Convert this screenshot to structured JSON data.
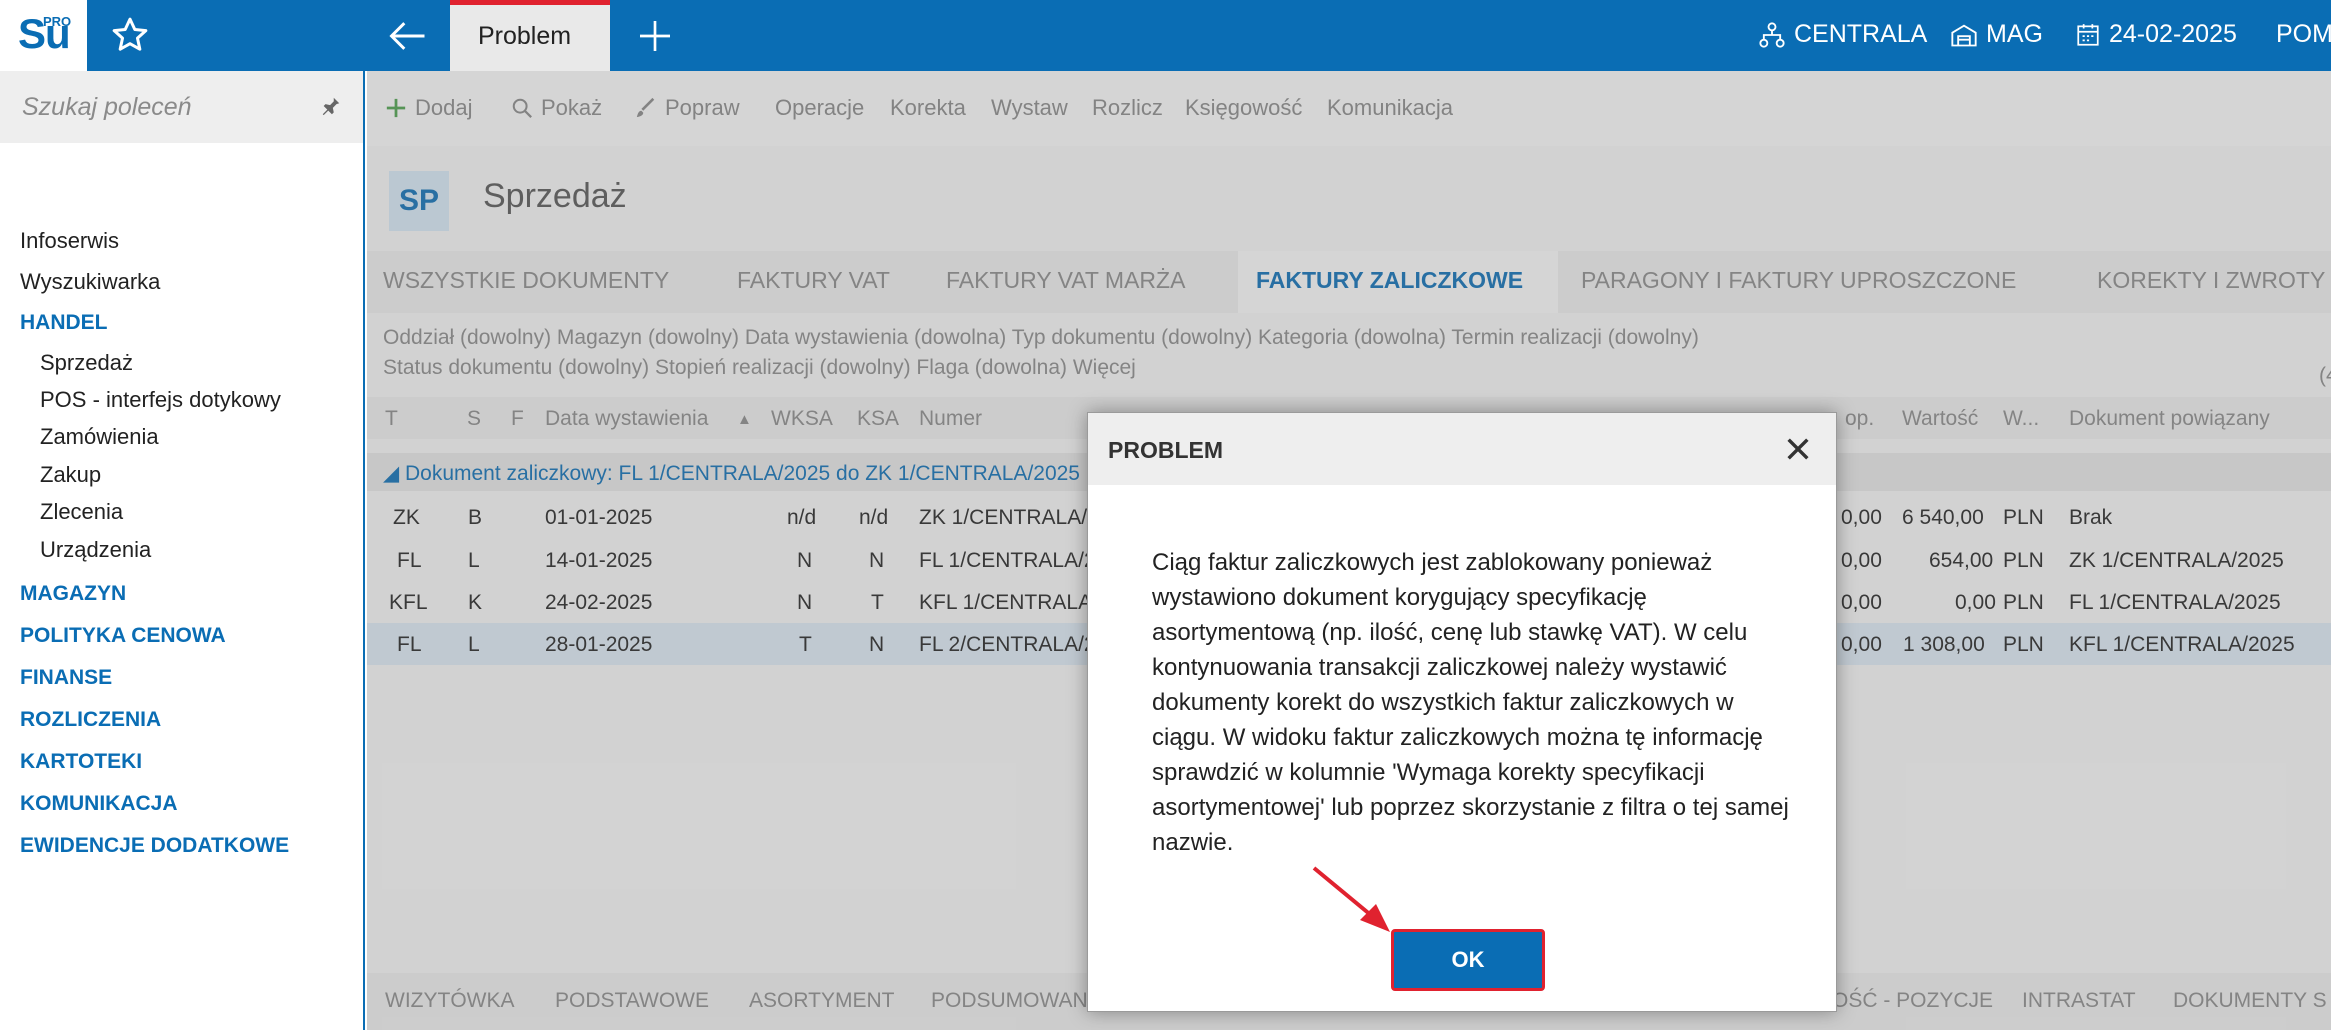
{
  "topbar": {
    "logo_text": "Su",
    "logo_sup": "PRO",
    "active_tab": "Problem",
    "centrala": "CENTRALA",
    "mag": "MAG",
    "date": "24-02-2025",
    "pom": "POM",
    "accent": "#0a6db4",
    "tab_border": "#e0222f"
  },
  "sidebar": {
    "search_placeholder": "Szukaj poleceń",
    "items": [
      {
        "label": "Infoserwis"
      },
      {
        "label": "Wyszukiwarka"
      },
      {
        "label": "HANDEL"
      },
      {
        "label": "Sprzedaż"
      },
      {
        "label": "POS - interfejs dotykowy"
      },
      {
        "label": "Zamówienia"
      },
      {
        "label": "Zakup"
      },
      {
        "label": "Zlecenia"
      },
      {
        "label": "Urządzenia"
      },
      {
        "label": "MAGAZYN"
      },
      {
        "label": "POLITYKA CENOWA"
      },
      {
        "label": "FINANSE"
      },
      {
        "label": "ROZLICZENIA"
      },
      {
        "label": "KARTOTEKI"
      },
      {
        "label": "KOMUNIKACJA"
      },
      {
        "label": "EWIDENCJE DODATKOWE"
      }
    ]
  },
  "toolbar": {
    "dodaj": "Dodaj",
    "pokaz": "Pokaż",
    "popraw": "Popraw",
    "operacje": "Operacje",
    "korekta": "Korekta",
    "wystaw": "Wystaw",
    "rozlicz": "Rozlicz",
    "ksiegowosc": "Księgowość",
    "komunikacja": "Komunikacja"
  },
  "view": {
    "badge": "SP",
    "title": "Sprzedaż",
    "tabs": [
      "WSZYSTKIE DOKUMENTY",
      "FAKTURY VAT",
      "FAKTURY VAT MARŻA",
      "FAKTURY ZALICZKOWE",
      "PARAGONY I FAKTURY UPROSZCZONE",
      "KOREKTY I ZWROTY"
    ],
    "filters1": "Oddział (dowolny)   Magazyn (dowolny)   Data wystawienia (dowolna)   Typ dokumentu (dowolny)   Kategoria (dowolna)   Termin realizacji (dowolny)",
    "filters2": "Status dokumentu (dowolny)   Stopień realizacji (dowolny)   Flaga (dowolna)   Więcej",
    "filters_count": "(4",
    "columns": {
      "t": "T",
      "s": "S",
      "f": "F",
      "data": "Data wystawienia",
      "sort_icon": "▲",
      "wksa": "WKSA",
      "ksa": "KSA",
      "numer": "Numer",
      "op": "op.",
      "wartosc": "Wartość",
      "w": "W...",
      "dok": "Dokument powiązany"
    },
    "group_label": "◢ Dokument zaliczkowy: FL 1/CENTRALA/2025 do ZK 1/CENTRALA/2025",
    "rows": [
      {
        "t": "ZK",
        "s": "B",
        "date": "01-01-2025",
        "wksa": "n/d",
        "ksa": "n/d",
        "numer": "ZK 1/CENTRALA/",
        "op": "0,00",
        "wartosc": "6 540,00",
        "w": "PLN",
        "dok": "Brak"
      },
      {
        "t": "FL",
        "s": "L",
        "date": "14-01-2025",
        "wksa": "N",
        "ksa": "N",
        "numer": "FL 1/CENTRALA/2",
        "op": "0,00",
        "wartosc": "654,00",
        "w": "PLN",
        "dok": "ZK 1/CENTRALA/2025"
      },
      {
        "t": "KFL",
        "s": "K",
        "date": "24-02-2025",
        "wksa": "N",
        "ksa": "T",
        "numer": "KFL 1/CENTRALA",
        "op": "0,00",
        "wartosc": "0,00",
        "w": "PLN",
        "dok": "FL 1/CENTRALA/2025"
      },
      {
        "t": "FL",
        "s": "L",
        "date": "28-01-2025",
        "wksa": "T",
        "ksa": "N",
        "numer": "FL 2/CENTRALA/2",
        "op": "0,00",
        "wartosc": "1 308,00",
        "w": "PLN",
        "dok": "KFL 1/CENTRALA/2025"
      }
    ],
    "bottom_tabs": [
      "WIZYTÓWKA",
      "PODSTAWOWE",
      "ASORTYMENT",
      "PODSUMOWAN",
      "OŚĆ - POZYCJE",
      "INTRASTAT",
      "DOKUMENTY S"
    ]
  },
  "dialog": {
    "title": "PROBLEM",
    "message": "Ciąg faktur zaliczkowych jest zablokowany ponieważ wystawiono dokument korygujący specyfikację asortymentową (np. ilość, cenę lub stawkę VAT). W celu kontynuowania transakcji zaliczkowej należy wystawić dokumenty korekt do wszystkich faktur zaliczkowych w ciągu. W widoku faktur zaliczkowych można tę informację sprawdzić w kolumnie 'Wymaga korekty specyfikacji asortymentowej' lub poprzez skorzystanie z filtra o tej samej nazwie.",
    "ok_label": "OK"
  }
}
